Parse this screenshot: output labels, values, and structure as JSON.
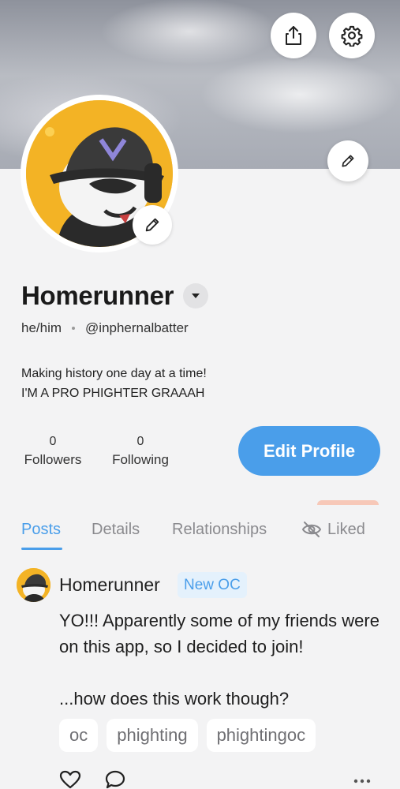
{
  "header": {
    "share_icon": "share-icon",
    "settings_icon": "gear-icon",
    "banner_edit_icon": "pencil-icon"
  },
  "profile": {
    "display_name": "Homerunner",
    "pronouns": "he/him",
    "handle": "@inphernalbatter",
    "bio_line_1": "Making history one day at a time!",
    "bio_line_2": "I'M A PRO PHIGHTER GRAAAH",
    "avatar_edit_icon": "pencil-icon"
  },
  "stats": {
    "followers_count": "0",
    "followers_label": "Followers",
    "following_count": "0",
    "following_label": "Following"
  },
  "edit_profile_label": "Edit Profile",
  "tabs": [
    {
      "label": "Posts",
      "active": true
    },
    {
      "label": "Details",
      "active": false
    },
    {
      "label": "Relationships",
      "active": false
    },
    {
      "label": "Liked",
      "active": false,
      "icon": "eye-slash-icon"
    }
  ],
  "post": {
    "author": "Homerunner",
    "badge": "New OC",
    "paragraph_1": "YO!!! Apparently some of my friends were on this app, so I decided to join!",
    "paragraph_2": "...how does this work though?",
    "tags": [
      "oc",
      "phighting",
      "phightingoc"
    ],
    "actions": [
      "heart-icon",
      "comment-icon",
      "more-icon"
    ]
  },
  "colors": {
    "accent": "#4a9eea",
    "background": "#f3f3f4",
    "badge_bg": "#e4f1fc"
  }
}
